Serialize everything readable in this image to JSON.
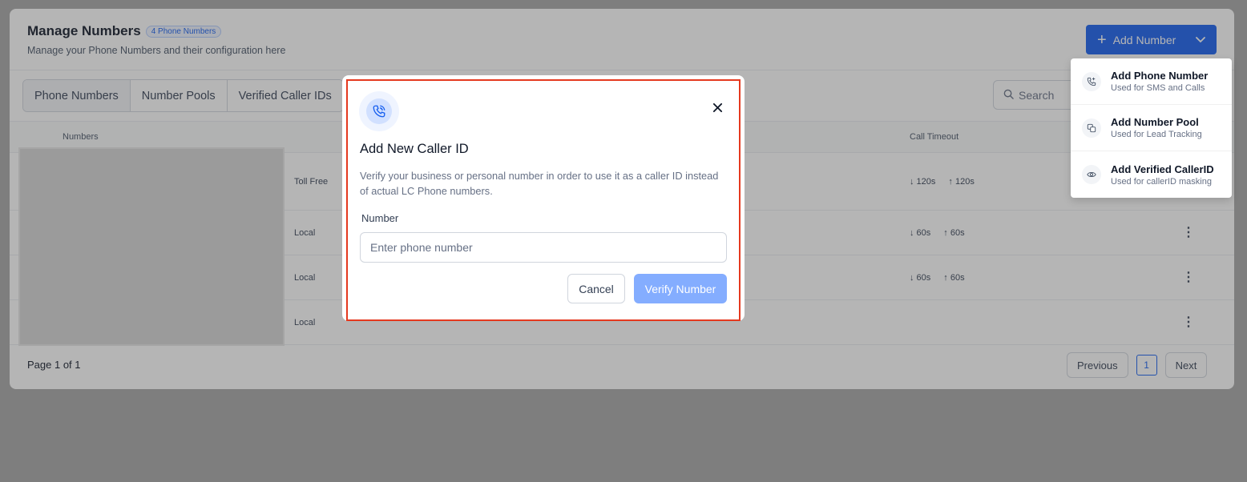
{
  "header": {
    "title": "Manage Numbers",
    "count_badge": "4 Phone Numbers",
    "subtitle": "Manage your Phone Numbers and their configuration here",
    "add_button_label": "Add Number"
  },
  "tabs": [
    {
      "label": "Phone Numbers",
      "active": true
    },
    {
      "label": "Number Pools",
      "active": false
    },
    {
      "label": "Verified Caller IDs",
      "active": false
    }
  ],
  "search": {
    "placeholder": "Search"
  },
  "table": {
    "columns": {
      "numbers": "Numbers",
      "call_timeout": "Call Timeout"
    },
    "rows": [
      {
        "type": "Toll Free",
        "timeout_in": "↓ 120s",
        "timeout_out": "↑ 120s"
      },
      {
        "type": "Local",
        "timeout_in": "↓ 60s",
        "timeout_out": "↑ 60s"
      },
      {
        "type": "Local",
        "timeout_in": "↓ 60s",
        "timeout_out": "↑ 60s"
      },
      {
        "type": "Local",
        "timeout_in": "",
        "timeout_out": ""
      }
    ]
  },
  "footer": {
    "page_info": "Page 1 of 1",
    "previous_label": "Previous",
    "current_page": "1",
    "next_label": "Next"
  },
  "dropdown_menu": {
    "items": [
      {
        "title": "Add Phone Number",
        "subtitle": "Used for SMS and Calls",
        "icon": "phone-plus-icon"
      },
      {
        "title": "Add Number Pool",
        "subtitle": "Used for Lead Tracking",
        "icon": "pool-icon"
      },
      {
        "title": "Add Verified CallerID",
        "subtitle": "Used for callerID masking",
        "icon": "eye-icon"
      }
    ]
  },
  "modal": {
    "title": "Add New Caller ID",
    "description": "Verify your business or personal number in order to use it as a caller ID instead of actual LC Phone numbers.",
    "field_label": "Number",
    "input_placeholder": "Enter phone number",
    "input_value": "",
    "cancel_label": "Cancel",
    "verify_label": "Verify Number"
  },
  "colors": {
    "primary": "#155eef",
    "primary_disabled": "#84adff",
    "highlight_outline": "#e5391f",
    "overlay": "#a6a6a6"
  }
}
